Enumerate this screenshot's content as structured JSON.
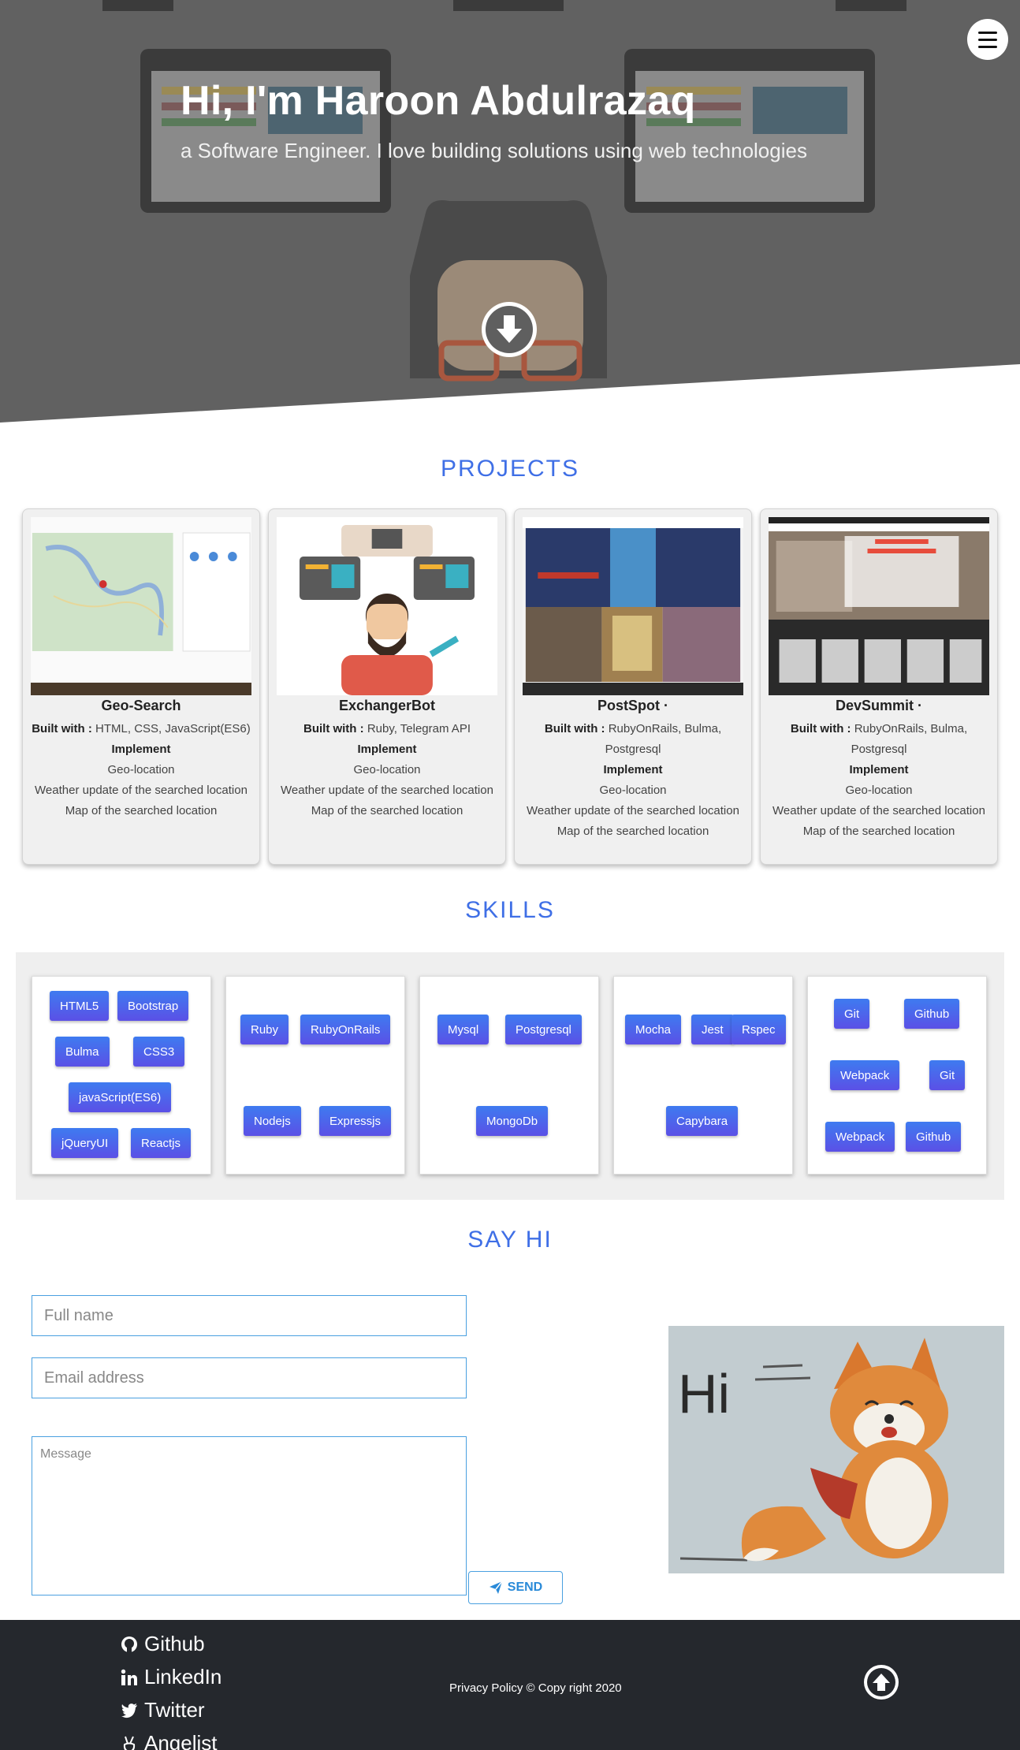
{
  "hero": {
    "title": "Hi, I'm Haroon Abdulrazaq",
    "subtitle": "a Software Engineer. I love building solutions using web technologies"
  },
  "projects": {
    "heading": "PROJECTS",
    "cards": [
      {
        "name": "Geo-Search",
        "built_label": "Built with :",
        "built_with": "HTML, CSS, JavaScript(ES6)",
        "implement_label": "Implement",
        "features": [
          "Geo-location",
          "Weather update of the searched location",
          "Map of the searched location"
        ]
      },
      {
        "name": "ExchangerBot",
        "built_label": "Built with :",
        "built_with": "Ruby, Telegram API",
        "implement_label": "Implement",
        "features": [
          "Geo-location",
          "Weather update of the searched location",
          "Map of the searched location"
        ]
      },
      {
        "name": "PostSpot ·",
        "built_label": "Built with :",
        "built_with": "RubyOnRails, Bulma, Postgresql",
        "implement_label": "Implement",
        "features": [
          "Geo-location",
          "Weather update of the searched location",
          "Map of the searched location"
        ]
      },
      {
        "name": "DevSummit ·",
        "built_label": "Built with :",
        "built_with": "RubyOnRails, Bulma, Postgresql",
        "implement_label": "Implement",
        "features": [
          "Geo-location",
          "Weather update of the searched location",
          "Map of the searched location"
        ]
      }
    ]
  },
  "skills": {
    "heading": "SKILLS",
    "groups": [
      [
        "HTML5",
        "Bootstrap",
        "Bulma",
        "CSS3",
        "javaScript(ES6)",
        "jQueryUI",
        "Reactjs"
      ],
      [
        "Ruby",
        "RubyOnRails",
        "Nodejs",
        "Expressjs"
      ],
      [
        "Mysql",
        "Postgresql",
        "MongoDb"
      ],
      [
        "Mocha",
        "Jest",
        "Rspec",
        "Capybara"
      ],
      [
        "Git",
        "Github",
        "Webpack",
        "Git",
        "Webpack",
        "Github"
      ]
    ]
  },
  "contact": {
    "heading": "SAY HI",
    "name_placeholder": "Full name",
    "email_placeholder": "Email address",
    "message_placeholder": "Message",
    "send_label": "SEND",
    "image_text": "Hi"
  },
  "footer": {
    "links": [
      "Github",
      "LinkedIn",
      "Twitter",
      "Angelist"
    ],
    "copyright": "Privacy Policy © Copy right 2020"
  },
  "colors": {
    "accent": "#3f6fe6",
    "chip": "#4a66ec",
    "footer_bg": "#25282d",
    "input_border": "#4aa0e0"
  }
}
